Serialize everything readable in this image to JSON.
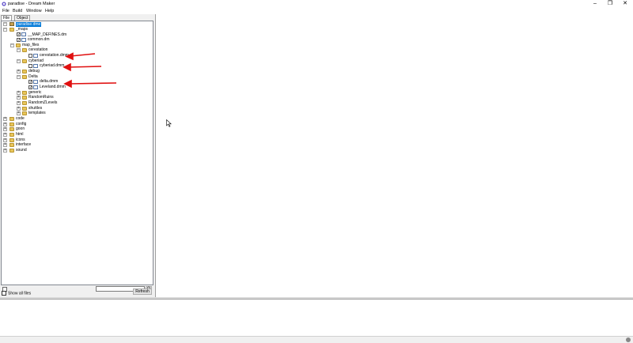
{
  "window": {
    "title": "paradise - Dream Maker",
    "minimize": "–",
    "restore": "❐",
    "close": "✕"
  },
  "menu": [
    "File",
    "Build",
    "Window",
    "Help"
  ],
  "tabs": {
    "file": "File",
    "object": "Object"
  },
  "tree": {
    "root": "paradise.dme",
    "maps": "_maps",
    "map_defines": "__MAP_DEFINES.dm",
    "common": "common.dm",
    "map_files": "map_files",
    "cerestation": "cerestation",
    "cerestation_dmm": "cerestation.dmm",
    "cyberiad": "cyberiad",
    "cyberiad_dmm": "cyberiad.dmm",
    "debug": "debug",
    "delta": "Delta",
    "delta_dmm": "delta.dmm",
    "leveland_dmm": "Leveland.dmm",
    "generic": "generic",
    "random_ruins": "RandomRuins",
    "random_zlevels": "RandomZLevels",
    "shuttles": "shuttles",
    "templates": "templates",
    "code": "code",
    "config": "config",
    "goon": "goon",
    "html": "html",
    "icons": "icons",
    "interface": "interface",
    "sound": "sound"
  },
  "bottom": {
    "search_value": "",
    "show_all_files": "Show all files",
    "refresh": "Refresh"
  },
  "colors": {
    "selection": "#0078d7",
    "arrow": "#e01010",
    "folder": "#e8c55a"
  }
}
